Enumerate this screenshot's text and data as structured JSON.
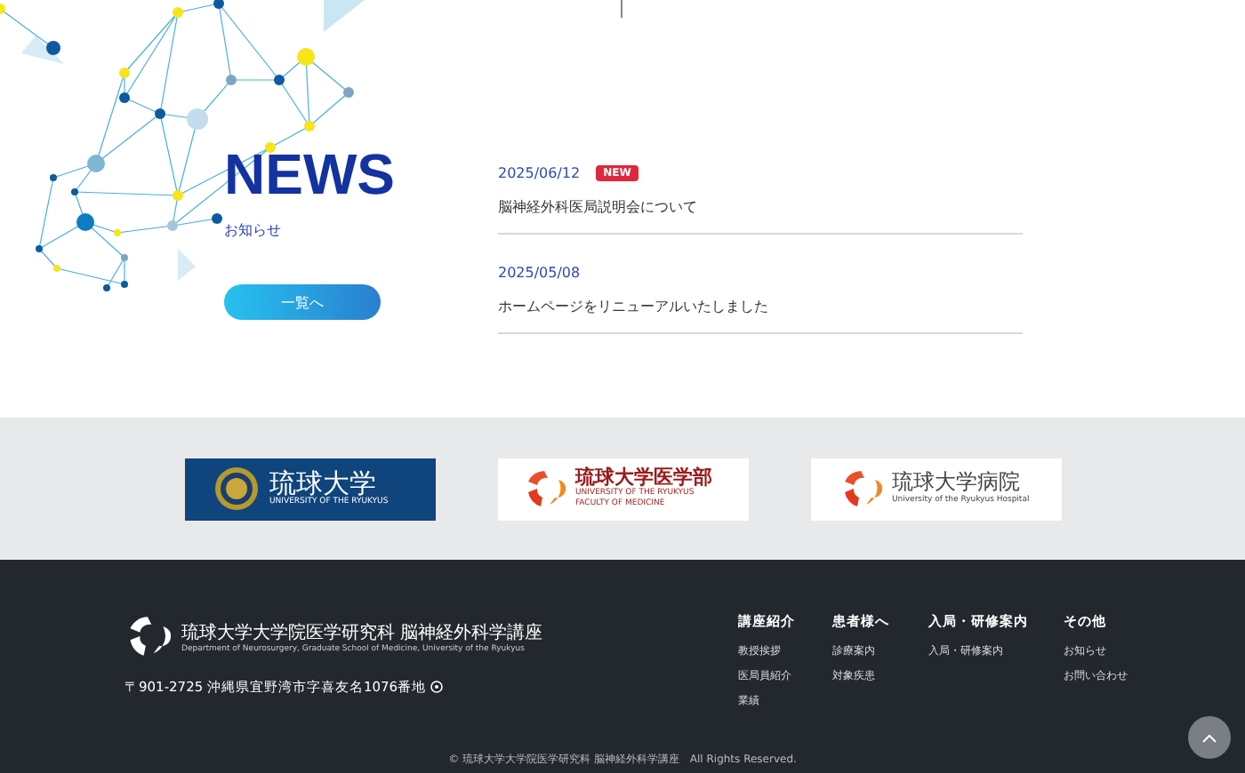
{
  "news": {
    "title": "NEWS",
    "subtitle": "お知らせ",
    "more_button": "一覧へ",
    "items": [
      {
        "date": "2025/06/12",
        "badge": "NEW",
        "text": "脳神経外科医局説明会について"
      },
      {
        "date": "2025/05/08",
        "text": "ホームページをリニューアルいたしました"
      }
    ]
  },
  "banners": [
    {
      "kind": "seal",
      "title": "琉球大学",
      "subtitle": "UNIVERSITY OF THE RYUKYUS"
    },
    {
      "kind": "medicine",
      "title": "琉球大学医学部",
      "subtitle": "UNIVERSITY OF THE RYUKYUS",
      "subtitle2": "FACULTY OF MEDICINE"
    },
    {
      "kind": "hospital",
      "title": "琉球大学病院",
      "subtitle": "University of the Ryukyus Hospital"
    }
  ],
  "footer": {
    "name": "琉球大学大学院医学研究科 脳神経外科学講座",
    "name_en": "Department of Neurosurgery, Graduate School of Medicine, University of the Ryukyus",
    "address": "〒901-2725 沖縄県宜野湾市字喜友名1076番地",
    "columns": [
      {
        "heading": "講座紹介",
        "links": [
          "教授挨拶",
          "医局員紹介",
          "業績"
        ]
      },
      {
        "heading": "患者様へ",
        "links": [
          "診療案内",
          "対象疾患"
        ]
      },
      {
        "heading": "入局・研修案内",
        "links": [
          "入局・研修案内"
        ]
      },
      {
        "heading": "その他",
        "links": [
          "お知らせ",
          "お問い合わせ"
        ]
      }
    ],
    "copyright": "© 琉球大学大学院医学研究科 脳神経外科学講座　All Rights Reserved."
  }
}
